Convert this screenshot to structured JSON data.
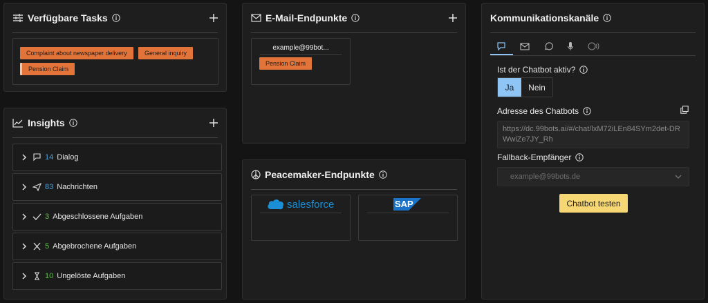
{
  "tasks": {
    "title": "Verfügbare Tasks",
    "tags": [
      "Complaint about newspaper delivery",
      "General inquiry",
      "Pension Claim"
    ]
  },
  "email": {
    "title": "E-Mail-Endpunkte",
    "address": "example@99bot...",
    "tag": "Pension Claim"
  },
  "insights": {
    "title": "Insights",
    "items": [
      {
        "count": "14",
        "label": "Dialog",
        "color": "#4aa3df"
      },
      {
        "count": "83",
        "label": "Nachrichten",
        "color": "#4aa3df"
      },
      {
        "count": "3",
        "label": "Abgeschlossene Aufgaben",
        "color": "#5fbf4a"
      },
      {
        "count": "5",
        "label": "Abgebrochene Aufgaben",
        "color": "#5fbf4a"
      },
      {
        "count": "10",
        "label": "Ungelöste Aufgaben",
        "color": "#5fbf4a"
      }
    ]
  },
  "peacemaker": {
    "title": "Peacemaker-Endpunkte",
    "logos": [
      "salesforce",
      "SAP"
    ]
  },
  "kanaele": {
    "title": "Kommunikationskanäle",
    "tabs": [
      "chat-icon",
      "mail-icon",
      "whatsapp-icon",
      "microphone-icon",
      "alexa-icon"
    ],
    "chatbot_active_label": "Ist der Chatbot aktiv?",
    "yes": "Ja",
    "no": "Nein",
    "address_label": "Adresse des Chatbots",
    "address_value": "https://dc.99bots.ai/#/chat/lxM72iLEn84SYm2det-DRWwiZe7JY_Rh",
    "fallback_label": "Fallback-Empfänger",
    "fallback_placeholder": "example@99bots.de",
    "test_button": "Chatbot testen"
  },
  "colors": {
    "accent_orange": "#e2743a",
    "toggle_active": "#8ec5f4",
    "test_button": "#f7d774",
    "count_blue": "#4aa3df",
    "count_green": "#5fbf4a"
  }
}
